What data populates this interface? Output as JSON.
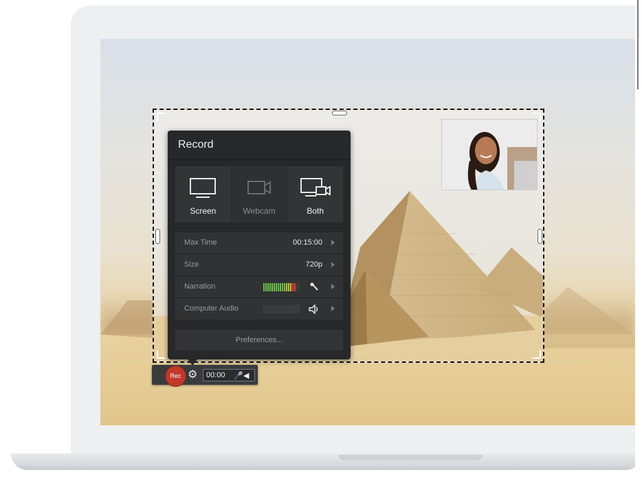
{
  "panel": {
    "title": "Record",
    "modes": [
      {
        "label": "Screen",
        "icon": "monitor-icon",
        "enabled": true
      },
      {
        "label": "Webcam",
        "icon": "webcam-icon",
        "enabled": false
      },
      {
        "label": "Both",
        "icon": "screen-and-webcam-icon",
        "enabled": true
      }
    ],
    "settings": {
      "max_time": {
        "label": "Max Time",
        "value": "00:15:00"
      },
      "size": {
        "label": "Size",
        "value": "720p"
      },
      "narration": {
        "label": "Narration",
        "level": 0.9,
        "icon": "microphone-icon"
      },
      "computer_audio": {
        "label": "Computer Audio",
        "level": 0,
        "icon": "speaker-icon"
      }
    },
    "preferences_label": "Preferences..."
  },
  "control_bar": {
    "rec_label": "Rec",
    "timer": "00:00",
    "icons": [
      "gear-icon",
      "microphone-icon",
      "speaker-icon"
    ]
  },
  "colors": {
    "rec": "#c0392b",
    "panel_bg": "#262829",
    "meter_green": "#6cc04a",
    "meter_red": "#e0402c"
  }
}
